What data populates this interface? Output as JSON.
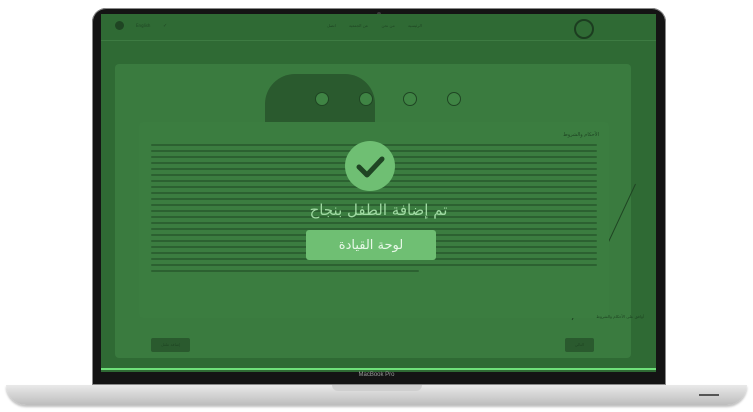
{
  "header": {
    "logo_text": "",
    "lang": "English",
    "nav_items": [
      "الرئيسية",
      "من نحن",
      "عن الجمعية",
      "اتصل"
    ]
  },
  "terms": {
    "title": "الأحكام والشروط",
    "agree_label": "أوافق على الأحكام والشروط"
  },
  "buttons": {
    "next": "التالي",
    "add_child": "إضافة طفل"
  },
  "modal": {
    "title": "تم إضافة الطفل بنجاح",
    "dashboard_button": "لوحة القيادة",
    "check_icon": "check-circle-icon"
  },
  "device": {
    "label": "MacBook Pro"
  },
  "colors": {
    "success": "#6fbf73",
    "overlay": "#2f6a34"
  }
}
